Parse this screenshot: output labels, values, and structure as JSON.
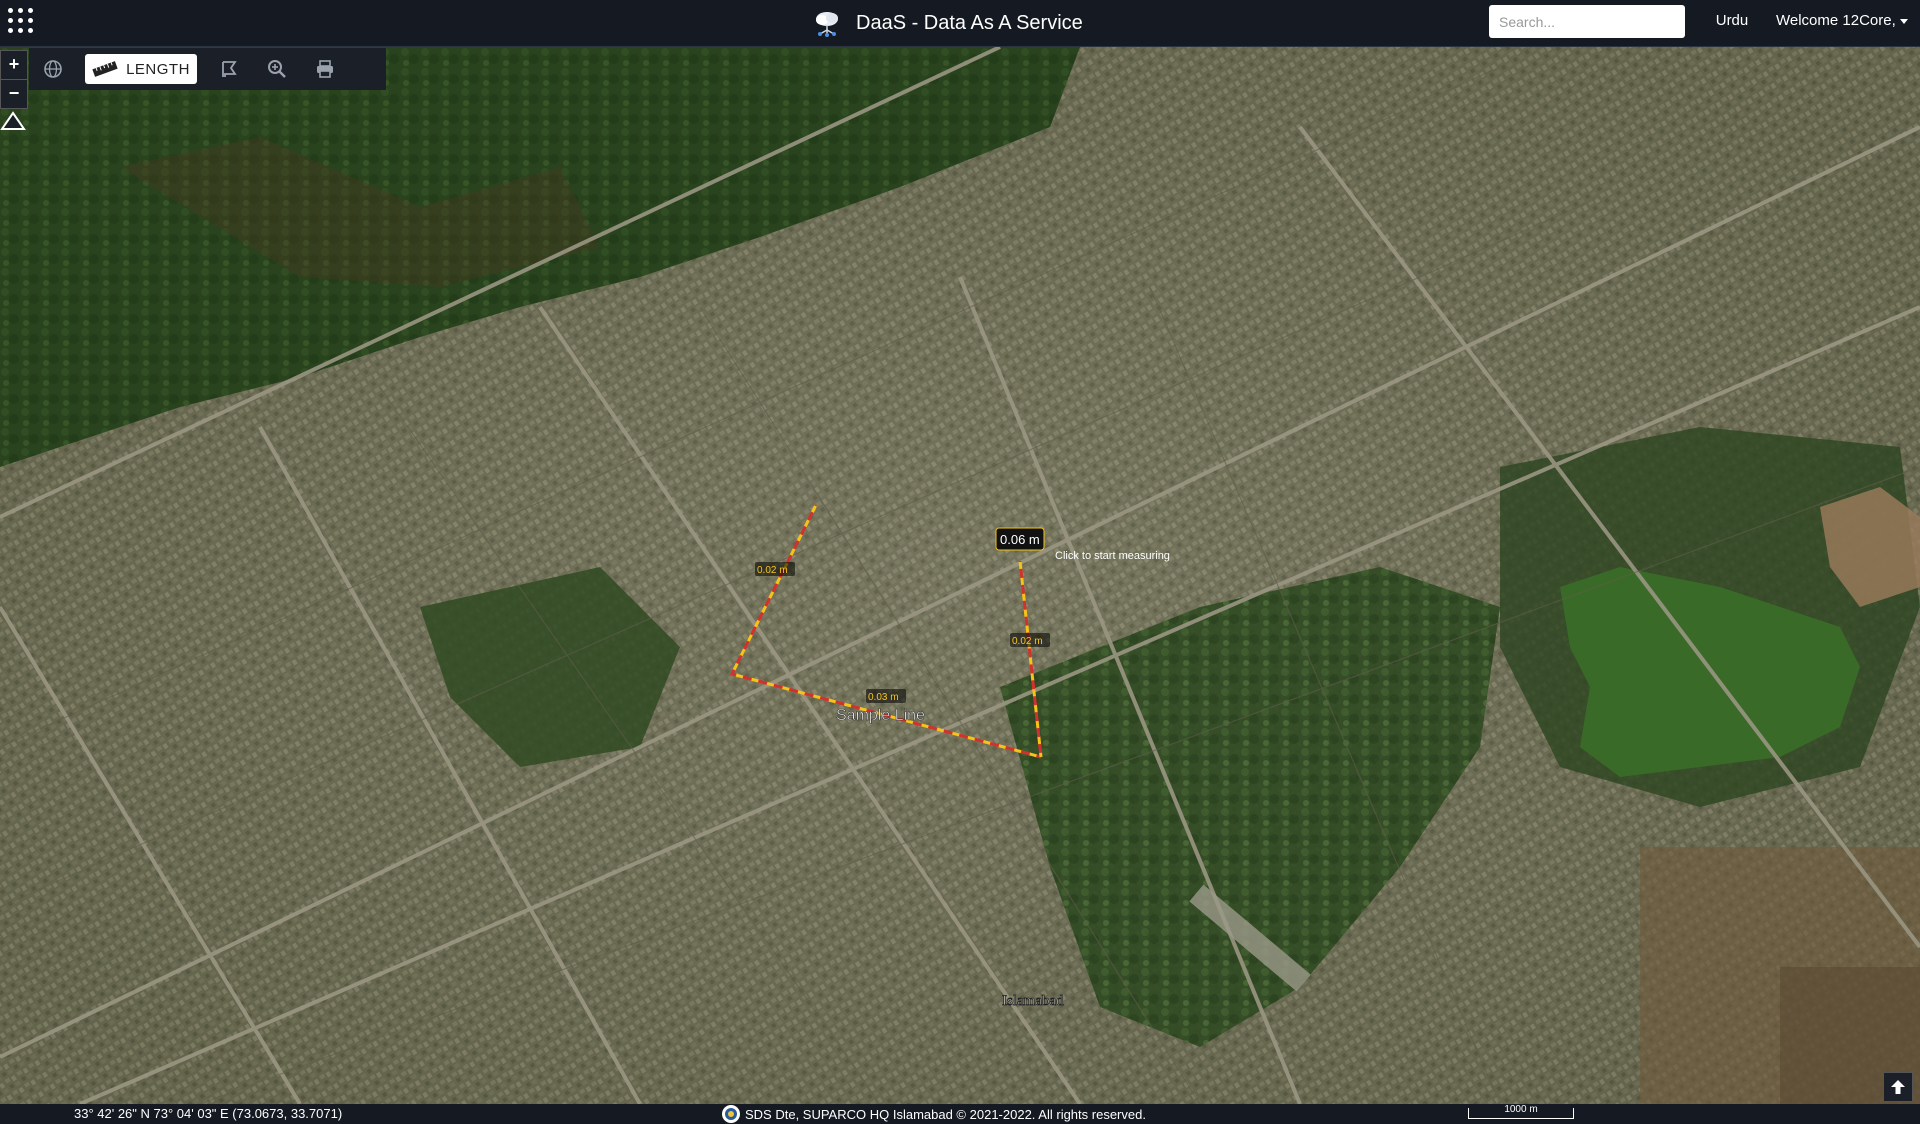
{
  "header": {
    "title": "DaaS - Data As A Service",
    "search_placeholder": "Search...",
    "language": "Urdu",
    "welcome": "Welcome 12Core,"
  },
  "toolbar": {
    "length_label": "LENGTH"
  },
  "map": {
    "segment_labels": [
      "0.02 m",
      "0.03 m",
      "0.02 m"
    ],
    "total_label": "0.06 m",
    "tooltip": "Click to start measuring",
    "line_name": "Sample Line",
    "place_label": "Islamabad",
    "accent_color": "#f6c419",
    "line_color": "#d2322d"
  },
  "status": {
    "coords": "33° 42' 26\" N 73° 04' 03\" E (73.0673, 33.7071)",
    "copyright": "SDS Dte, SUPARCO HQ Islamabad © 2021-2022. All rights reserved.",
    "scale": "1000 m"
  }
}
